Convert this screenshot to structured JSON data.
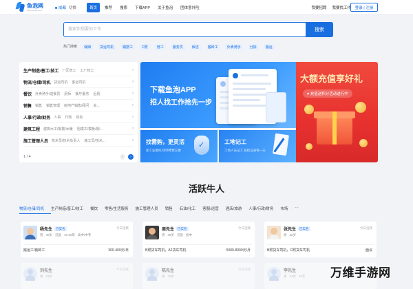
{
  "header": {
    "logo_name": "鱼泡网",
    "logo_sub": "www.yupao.com",
    "city": "成都",
    "switch_city": "切换",
    "nav": [
      "首页",
      "推荐",
      "搜索",
      "下载APP",
      "关于鱼泡",
      "团体意外险"
    ],
    "right_links": [
      "我要招聘",
      "我要找工作"
    ],
    "login_label": "登录 | 注册"
  },
  "search": {
    "placeholder": "搜索你想要的工作",
    "button_label": "搜索",
    "hot_label": "热门搜索",
    "hot_tags": [
      "保姆",
      "货运司机",
      "钢筋工",
      "C照",
      "普工",
      "服务员",
      "保洁",
      "搬砖工",
      "外卖骑手",
      "分拣",
      "搬运"
    ]
  },
  "categories": {
    "rows": [
      {
        "title": "生产制造/普工/技工",
        "subs": [
          "厂区普工",
          "工厂技工"
        ]
      },
      {
        "title": "物流/仓储/司机",
        "subs": [
          "货运司机",
          "客运司机"
        ]
      },
      {
        "title": "餐饮",
        "subs": [
          "外卖骑手/送餐员",
          "厨师",
          "餐厅服务",
          "后厨"
        ]
      },
      {
        "title": "销售",
        "subs": [
          "销售",
          "销售管理",
          "房地产销售/顾问",
          "会..."
        ]
      },
      {
        "title": "人事/行政/财务",
        "subs": [
          "人事",
          "行政",
          "财务"
        ]
      },
      {
        "title": "建筑工程",
        "subs": [
          "建筑木工/钢筋/水暖",
          "铝模工/模板/钢...",
          "..."
        ]
      },
      {
        "title": "施工管理人员",
        "subs": [
          "技术员/技术负责人",
          "施工员/技术..."
        ]
      }
    ],
    "page": "1 / 4"
  },
  "banners": {
    "main_line1": "下载鱼泡APP",
    "main_line2": "招人找工作抢先一步",
    "red_title": "大额充值享好礼",
    "red_sub": "♥ 充值送积分活动进行中",
    "small1_title": "找需购，更灵活",
    "small1_sub": "加工业委托 找师傅更方便",
    "small2_title": "工地记工",
    "small2_sub": "工地人员记工 轻松记录每一天"
  },
  "talents": {
    "title": "活跃牛人",
    "tabs": [
      "物流/仓储/司机",
      "生产制造/普工/技工",
      "餐饮",
      "零售/生活服务",
      "施工管理人员",
      "销售",
      "石油/化工",
      "客服/运营",
      "酒店/旅游",
      "人事/行政/财务",
      "市场",
      "···"
    ],
    "cards": [
      {
        "name": "杨先生",
        "badge": "已实名",
        "status": "今日活跃",
        "meta": [
          "男",
          "40岁",
          "汉族",
          "10-20年",
          "高中/中专"
        ],
        "job": "搬运工/装卸工",
        "salary": "300-400元/日"
      },
      {
        "name": "周先生",
        "badge": "已实名",
        "status": "今日活跃",
        "meta": [
          "男",
          "46岁",
          "汉族",
          "初中"
        ],
        "job": "B照货车司机，A2货车司机",
        "salary": "5000-8000元/月"
      },
      {
        "name": "张先生",
        "badge": "已实名",
        "status": "今日活跃",
        "meta": [
          "男",
          "32岁"
        ],
        "job": "B照货车司机，C照货车司机",
        "salary": "面议"
      }
    ],
    "faded_cards": [
      {
        "name": "刘先生",
        "meta": [
          "男",
          "23岁"
        ],
        "status": "今日活跃"
      },
      {
        "name": "陈先生",
        "meta": [
          "男",
          "30岁"
        ],
        "status": "今日活跃"
      },
      {
        "name": "李先生",
        "meta": [
          "男",
          "24岁",
          "10年"
        ],
        "status": "今日活跃"
      }
    ]
  },
  "watermark": "万维手游网",
  "colors": {
    "brand": "#1a6fe0",
    "red_banner": "#e8322f",
    "page_bg": "#f1f3f7"
  }
}
